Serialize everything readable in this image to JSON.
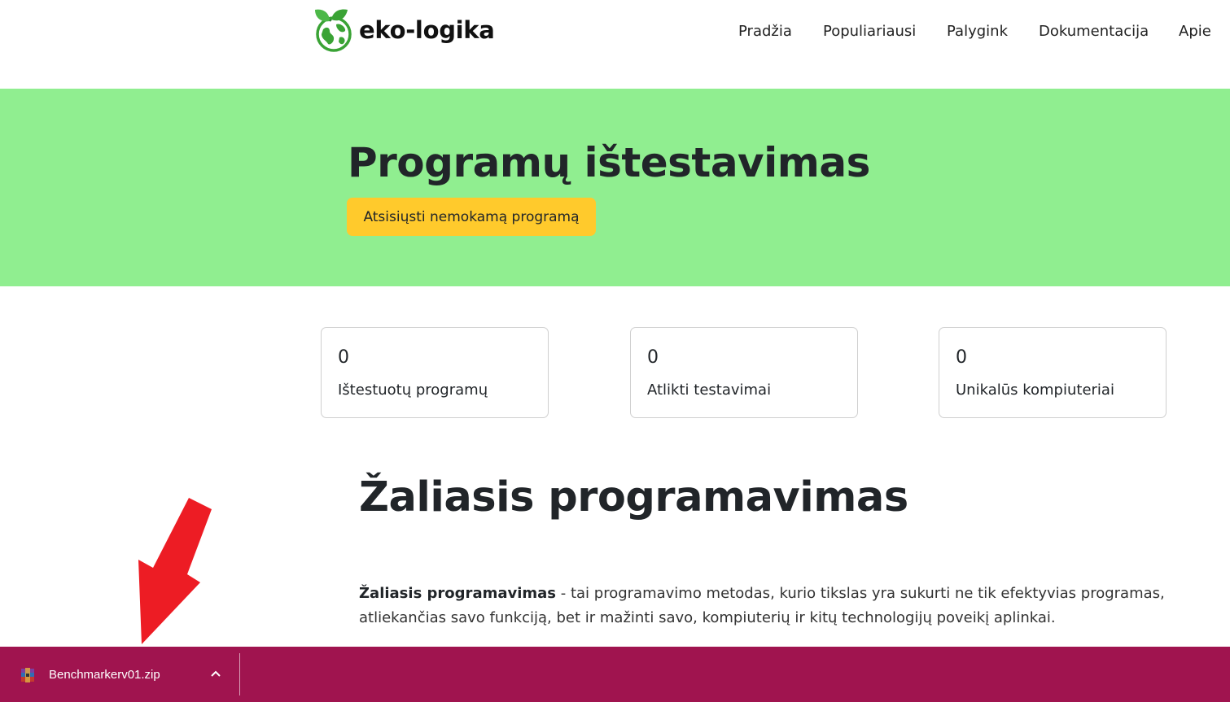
{
  "brand": {
    "name": "eko-logika",
    "logo_icon": "globe-leaves-icon",
    "logo_color": "#3aa335"
  },
  "nav": {
    "items": [
      {
        "label": "Pradžia"
      },
      {
        "label": "Populiariausi"
      },
      {
        "label": "Palygink"
      },
      {
        "label": "Dokumentacija"
      },
      {
        "label": "Apie"
      }
    ]
  },
  "hero": {
    "title": "Programų ištestavimas",
    "download_button": "Atsisiųsti nemokamą programą",
    "background_color": "#90ee90",
    "button_color": "#ffca2c"
  },
  "stats": [
    {
      "value": "0",
      "label": "Ištestuotų programų"
    },
    {
      "value": "0",
      "label": "Atlikti testavimai"
    },
    {
      "value": "0",
      "label": "Unikalūs kompiuteriai"
    }
  ],
  "section": {
    "title": "Žaliasis programavimas",
    "paragraph_bold": "Žaliasis programavimas",
    "paragraph_rest": " - tai programavimo metodas, kurio tikslas yra sukurti ne tik efektyvias programas, atliekančias savo funkciją, bet ir mažinti savo, kompiuterių ir kitų technologijų poveikį aplinkai."
  },
  "annotation": {
    "arrow_icon": "red-arrow-icon",
    "color": "#ed1c24"
  },
  "download_bar": {
    "filename": "Benchmarkerv01.zip",
    "file_icon": "winrar-archive-icon",
    "chevron_icon": "chevron-up-icon",
    "background_color": "#a0144f"
  }
}
